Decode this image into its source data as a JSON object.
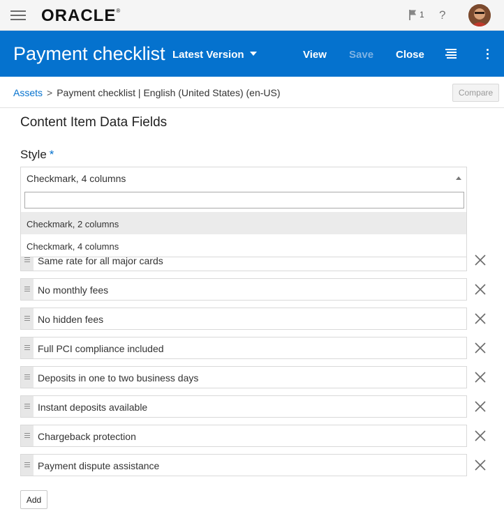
{
  "topbar": {
    "logo": "ORACLE",
    "logo_mark": "®",
    "notification_count": "1",
    "help_glyph": "?"
  },
  "header": {
    "title": "Payment checklist",
    "version_label": "Latest Version",
    "view_label": "View",
    "save_label": "Save",
    "close_label": "Close"
  },
  "breadcrumb": {
    "root": "Assets",
    "separator": ">",
    "current": "Payment checklist | English (United States) (en-US)"
  },
  "compare_label": "Compare",
  "section_title": "Content Item Data Fields",
  "style_field": {
    "label": "Style",
    "required_mark": "*",
    "selected": "Checkmark, 4 columns",
    "search_value": "",
    "options": [
      "Checkmark, 2 columns",
      "Checkmark, 4 columns"
    ]
  },
  "items": [
    "Same rate for all major cards",
    "No monthly fees",
    "No hidden fees",
    "Full PCI compliance included",
    "Deposits in one to two business days",
    "Instant deposits available",
    "Chargeback protection",
    "Payment dispute assistance"
  ],
  "add_label": "Add",
  "colors": {
    "brand_blue": "#0572ce",
    "topbar_bg": "#f5f5f5"
  }
}
